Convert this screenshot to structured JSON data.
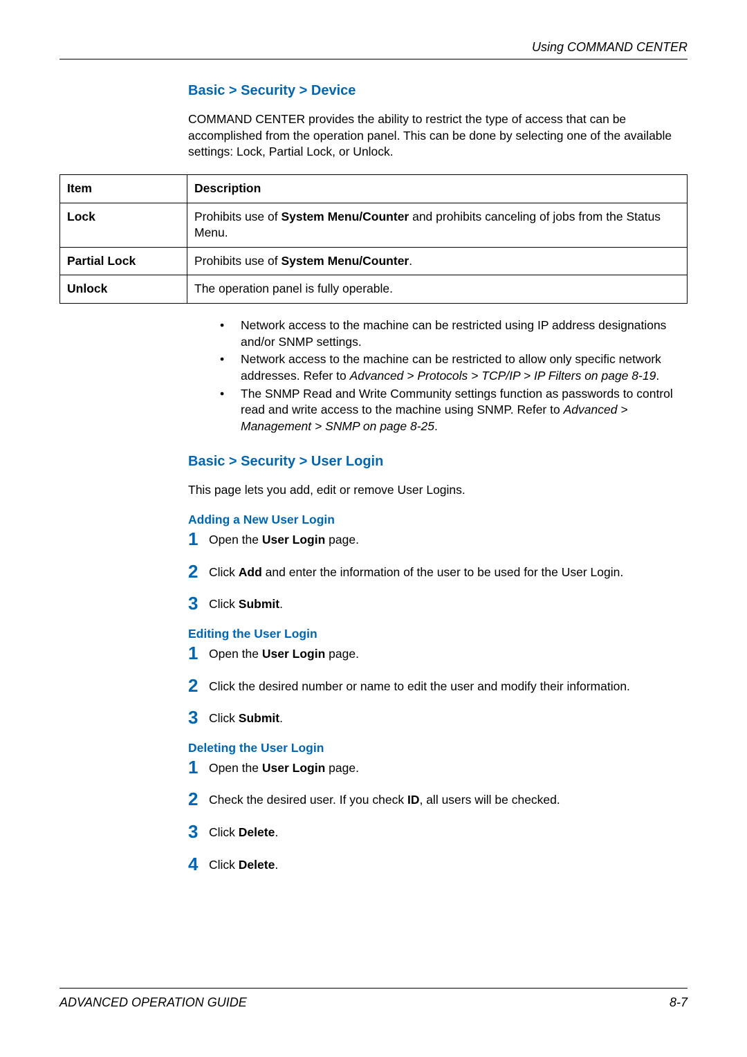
{
  "header": "Using COMMAND CENTER",
  "section1": {
    "title": "Basic > Security > Device",
    "intro": "COMMAND CENTER provides the ability to restrict the type of access that can be accomplished from the operation panel. This can be done by selecting one of the available settings: Lock, Partial Lock, or Unlock."
  },
  "table": {
    "h1": "Item",
    "h2": "Description",
    "rows": [
      {
        "item": "Lock",
        "desc_pre": "Prohibits use of ",
        "desc_bold": "System Menu/Counter",
        "desc_post": " and prohibits canceling of jobs from the Status Menu."
      },
      {
        "item": "Partial Lock",
        "desc_pre": "Prohibits use of ",
        "desc_bold": "System Menu/Counter",
        "desc_post": "."
      },
      {
        "item": "Unlock",
        "desc_pre": "The operation panel is fully operable.",
        "desc_bold": "",
        "desc_post": ""
      }
    ]
  },
  "bullets": {
    "b1": "Network access to the machine can be restricted using IP address designations and/or SNMP settings.",
    "b2_pre": "Network access to the machine can be restricted to allow only specific network addresses. Refer to ",
    "b2_italic": "Advanced > Protocols > TCP/IP > IP Filters on page 8-19",
    "b2_post": ".",
    "b3_pre": "The SNMP Read and Write Community settings function as passwords to control read and write access to the machine using SNMP. Refer to ",
    "b3_italic": "Advanced > Management > SNMP on page 8-25",
    "b3_post": "."
  },
  "section2": {
    "title": "Basic > Security > User Login",
    "intro": "This page lets you add, edit or remove User Logins."
  },
  "adding": {
    "title": "Adding a New User Login",
    "s1_pre": "Open the ",
    "s1_bold": "User Login",
    "s1_post": " page.",
    "s2_pre": "Click ",
    "s2_bold": "Add",
    "s2_post": " and enter the information of the user to be used for the User Login.",
    "s3_pre": "Click ",
    "s3_bold": "Submit",
    "s3_post": "."
  },
  "editing": {
    "title": "Editing the User Login",
    "s1_pre": "Open the ",
    "s1_bold": "User Login",
    "s1_post": " page.",
    "s2": "Click the desired number or name to edit the user and modify their information.",
    "s3_pre": "Click ",
    "s3_bold": "Submit",
    "s3_post": "."
  },
  "deleting": {
    "title": "Deleting the User Login",
    "s1_pre": "Open the ",
    "s1_bold": "User Login",
    "s1_post": " page.",
    "s2_pre": "Check the desired user. If you check ",
    "s2_bold": "ID",
    "s2_post": ", all users will be checked.",
    "s3_pre": "Click ",
    "s3_bold": "Delete",
    "s3_post": ".",
    "s4_pre": "Click ",
    "s4_bold": "Delete",
    "s4_post": "."
  },
  "footer": {
    "left": "ADVANCED OPERATION GUIDE",
    "right": "8-7"
  },
  "nums": {
    "n1": "1",
    "n2": "2",
    "n3": "3",
    "n4": "4"
  },
  "dot": "•"
}
